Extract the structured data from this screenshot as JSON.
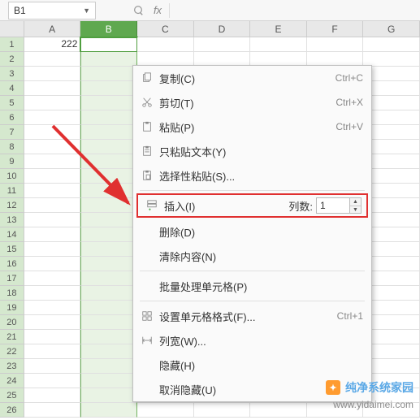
{
  "formula_bar": {
    "cell_ref": "B1",
    "fx_label": "fx"
  },
  "columns": [
    "A",
    "B",
    "C",
    "D",
    "E",
    "F",
    "G"
  ],
  "selected_column_index": 1,
  "row_count": 26,
  "cell_A1": "222",
  "context_menu": {
    "copy": {
      "label": "复制(C)",
      "shortcut": "Ctrl+C"
    },
    "cut": {
      "label": "剪切(T)",
      "shortcut": "Ctrl+X"
    },
    "paste": {
      "label": "粘贴(P)",
      "shortcut": "Ctrl+V"
    },
    "paste_text": {
      "label": "只粘贴文本(Y)"
    },
    "paste_special": {
      "label": "选择性粘贴(S)..."
    },
    "insert": {
      "label": "插入(I)",
      "count_label": "列数:",
      "count_value": "1"
    },
    "delete": {
      "label": "删除(D)"
    },
    "clear": {
      "label": "清除内容(N)"
    },
    "batch": {
      "label": "批量处理单元格(P)"
    },
    "format_cells": {
      "label": "设置单元格格式(F)...",
      "shortcut": "Ctrl+1"
    },
    "col_width": {
      "label": "列宽(W)..."
    },
    "hide": {
      "label": "隐藏(H)"
    },
    "unhide": {
      "label": "取消隐藏(U)"
    }
  },
  "watermark": {
    "brand": "纯净系统家园",
    "url": "www.yidaimei.com"
  },
  "icons": {
    "copy": "copy-icon",
    "cut": "scissors-icon",
    "paste": "clipboard-icon",
    "paste_text": "clipboard-text-icon",
    "paste_special": "clipboard-special-icon",
    "insert": "insert-row-icon",
    "format_cells": "format-cells-icon",
    "col_width": "column-width-icon"
  }
}
